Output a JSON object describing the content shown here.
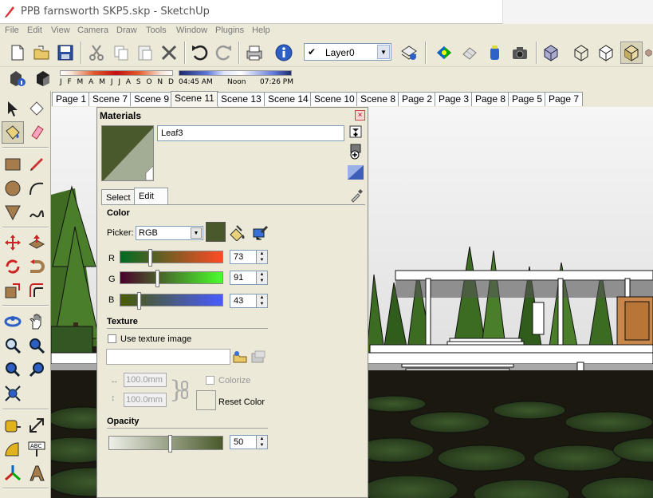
{
  "window": {
    "title": "PPB farnsworth SKP5.skp - SketchUp"
  },
  "menu": [
    "File",
    "Edit",
    "View",
    "Camera",
    "Draw",
    "Tools",
    "Window",
    "Plugins",
    "Help"
  ],
  "layer": {
    "value": "Layer0"
  },
  "shadow": {
    "months": "J F M A M J J A S O N D",
    "time_start": "04:45 AM",
    "time_mid": "Noon",
    "time_end": "07:26 PM"
  },
  "scenes": [
    "Page 1",
    "Scene 7",
    "Scene 9",
    "Scene 11",
    "Scene 13",
    "Scene 14",
    "Scene 10",
    "Scene 8",
    "Page 2",
    "Page 3",
    "Page 8",
    "Page 5",
    "Page 7"
  ],
  "active_scene": "Scene 11",
  "materials": {
    "title": "Materials",
    "close": "×",
    "name": "Leaf3",
    "tabs": {
      "select": "Select",
      "edit": "Edit"
    },
    "color_section": "Color",
    "picker_label": "Picker:",
    "picker_value": "RGB",
    "r_label": "R",
    "r_value": "73",
    "g_label": "G",
    "g_value": "91",
    "b_label": "B",
    "b_value": "43",
    "texture_section": "Texture",
    "use_texture": "Use texture image",
    "width_value": "100.0mm",
    "height_value": "100.0mm",
    "colorize": "Colorize",
    "reset_color": "Reset Color",
    "opacity_section": "Opacity",
    "opacity_value": "50",
    "colors": {
      "swatch": "#49592b",
      "swatch_translucent": "#a3ac95"
    }
  }
}
